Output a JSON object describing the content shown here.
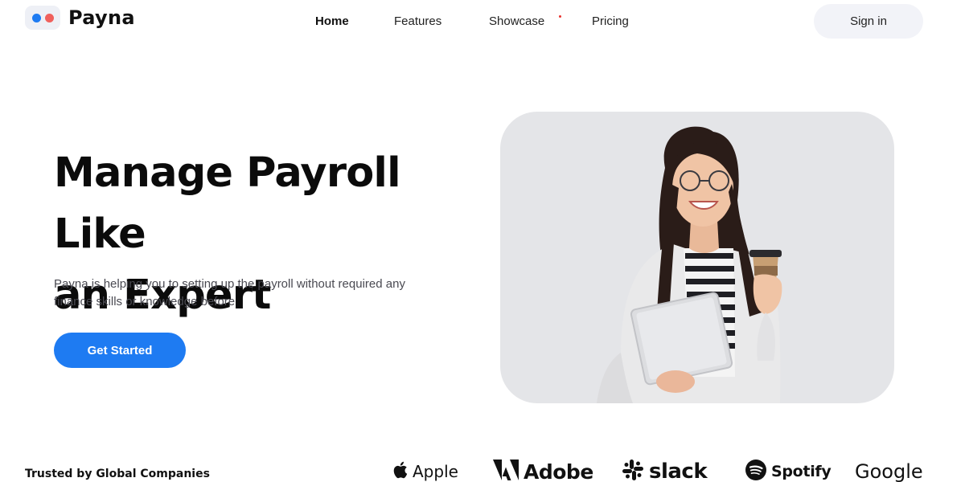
{
  "app": {
    "brand_name": "Payna",
    "logo_icon": "two-dots-logo",
    "accent_color": "#1e7bf2",
    "secondary_color": "#f0605c"
  },
  "nav": {
    "items": [
      {
        "label": "Home",
        "active": true
      },
      {
        "label": "Features",
        "active": false
      },
      {
        "label": "Showcase",
        "active": false,
        "indicator": "notification-dot"
      },
      {
        "label": "Pricing",
        "active": false
      }
    ],
    "signin_label": "Sign in"
  },
  "hero": {
    "title_line1": "Manage Payroll Like",
    "title_line2": "an Expert",
    "subtitle_line1": "Payna is helping you to setting up the payroll without required any",
    "subtitle_line2": "finance skills or knowledge before",
    "cta_label": "Get Started",
    "image_subject": "smiling-businesswoman-with-laptop-and-coffee-photo"
  },
  "trusted": {
    "label": "Trusted by Global Companies",
    "brands": [
      {
        "name": "Apple",
        "icon": "apple-icon"
      },
      {
        "name": "Adobe",
        "icon": "adobe-icon"
      },
      {
        "name": "slack",
        "icon": "slack-icon"
      },
      {
        "name": "Spotify",
        "icon": "spotify-icon"
      },
      {
        "name": "Google",
        "icon": "none"
      }
    ]
  }
}
